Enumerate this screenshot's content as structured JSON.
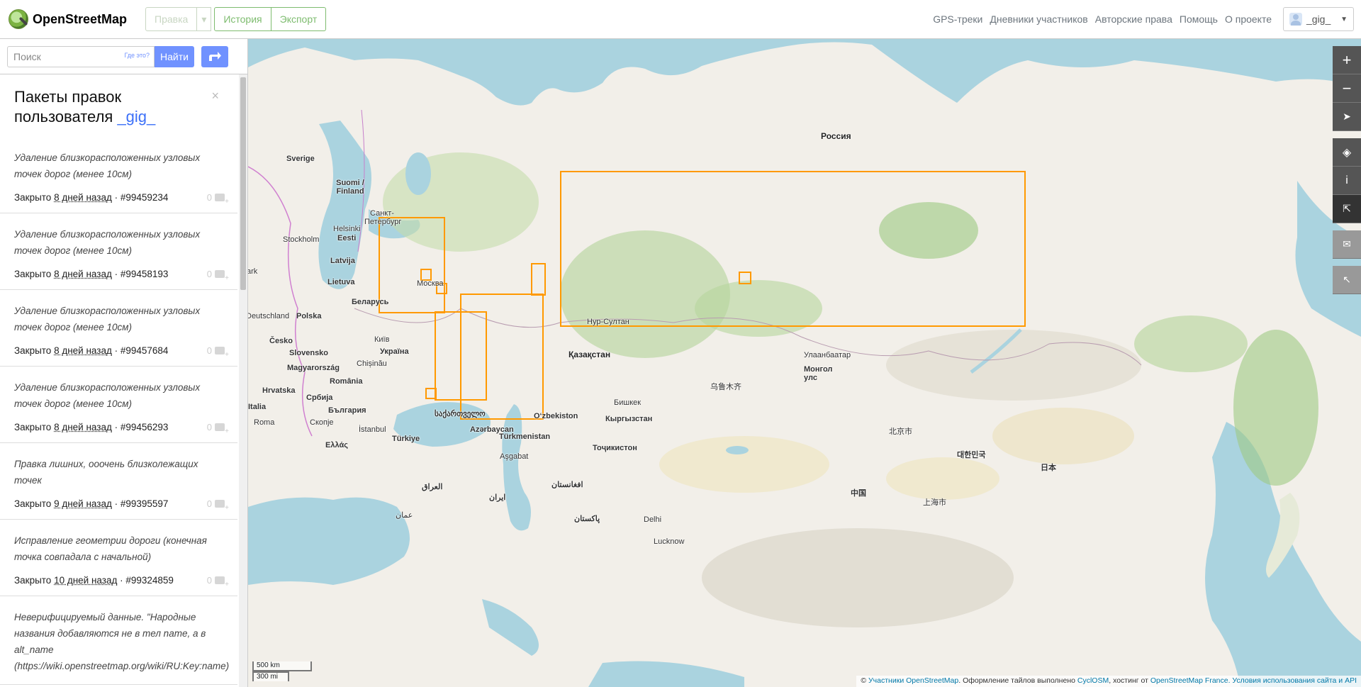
{
  "header": {
    "logo_text": "OpenStreetMap",
    "edit_label": "Правка",
    "history_label": "История",
    "export_label": "Экспорт",
    "links": [
      "GPS-треки",
      "Дневники участников",
      "Авторские права",
      "Помощь",
      "О проекте"
    ],
    "user_name": "_gig_"
  },
  "search": {
    "placeholder": "Поиск",
    "whereis": "Где это?",
    "button": "Найти"
  },
  "panel": {
    "title_prefix": "Пакеты правок пользователя ",
    "title_user": "_gig_",
    "close": "×"
  },
  "changesets": [
    {
      "comment": "Удаление близкорасположенных узловых точек дорог (менее 10см)",
      "status": "Закрыто ",
      "ago": "8 дней назад",
      "id": " · #99459234",
      "count": "0"
    },
    {
      "comment": "Удаление близкорасположенных узловых точек дорог (менее 10см)",
      "status": "Закрыто ",
      "ago": "8 дней назад",
      "id": " · #99458193",
      "count": "0"
    },
    {
      "comment": "Удаление близкорасположенных узловых точек дорог (менее 10см)",
      "status": "Закрыто ",
      "ago": "8 дней назад",
      "id": " · #99457684",
      "count": "0"
    },
    {
      "comment": "Удаление близкорасположенных узловых точек дорог (менее 10см)",
      "status": "Закрыто ",
      "ago": "8 дней назад",
      "id": " · #99456293",
      "count": "0"
    },
    {
      "comment": "Правка лишних, ооочень близколежащих точек",
      "status": "Закрыто ",
      "ago": "9 дней назад",
      "id": " · #99395597",
      "count": "0"
    },
    {
      "comment": "Исправление геометрии дороги (конечная точка совпадала с начальной)",
      "status": "Закрыто ",
      "ago": "10 дней назад",
      "id": " · #99324859",
      "count": "0"
    },
    {
      "comment": "Неверифицируемый данные. \"Народные названия добавляются не в тел name, а в alt_name (https://wiki.openstreetmap.org/wiki/RU:Key:name)",
      "status": "",
      "ago": "",
      "id": "",
      "count": ""
    }
  ],
  "map": {
    "labels": {
      "russia": "Россия",
      "sverige": "Sverige",
      "suomi": "Suomi / Finland",
      "spb": "Санкт-Петербург",
      "helsinki": "Helsinki",
      "stockholm": "Stockholm",
      "eesti": "Eesti",
      "latvija": "Latvija",
      "lietuva": "Lietuva",
      "moskva": "Москва",
      "belarus": "Беларусь",
      "polska": "Polska",
      "ukraina": "Україна",
      "kyiv": "Київ",
      "cesko": "Česko",
      "slovensko": "Slovensko",
      "magyar": "Magyarország",
      "romania": "România",
      "chisinau": "Chișinău",
      "hrvatska": "Hrvatska",
      "srbija": "Србија",
      "bulgaria": "България",
      "italia": "Italia",
      "roma": "Roma",
      "skopje": "Скопје",
      "ellas": "Ελλάς",
      "istanbul": "İstanbul",
      "turkiye": "Türkiye",
      "sakartvelo": "საქართველო",
      "azerbaycan": "Azərbaycan",
      "kazakhstan": "Қазақстан",
      "nursultan": "Нур-Султан",
      "uzbekistan": "O‘zbekiston",
      "turkmenistan": "Türkmenistan",
      "ashgabat": "Aşgabat",
      "kyrgyzstan": "Кыргызстан",
      "bishkek": "Бишкек",
      "tajikistan": "Тоҷикистон",
      "iran": "ایران",
      "iraq": "العراق",
      "afghanistan": "افغانستان",
      "pakistan": "پاکستان",
      "mongolia": "Монгол улс",
      "ulaanbaatar": "Улаанбаатар",
      "china": "中国",
      "nihon": "日本",
      "korea": "대한민국",
      "urumqi": "乌鲁木齐",
      "beijing": "北京市",
      "shanghai": "上海市",
      "delhi": "Delhi",
      "hlanar": "Lucknow",
      "amman": "عمان",
      "berlin": "Deutschland",
      "sakharak": "ark"
    },
    "scale_km": "500 km",
    "scale_mi": "300 mi",
    "attribution_prefix": "© ",
    "attribution_osm": "Участники OpenStreetMap",
    "attribution_mid": ". Оформление тайлов выполнено ",
    "attribution_cyclosm": "CyclOSM",
    "attribution_host": ", хостинг от ",
    "attribution_france": "OpenStreetMap France",
    "attribution_end": ". Условия использования сайта и API"
  },
  "colors": {
    "accent": "#7ebc6f",
    "link": "#7092ff",
    "bbox": "#ff9900",
    "water": "#aad3df",
    "land": "#f2efe9"
  }
}
